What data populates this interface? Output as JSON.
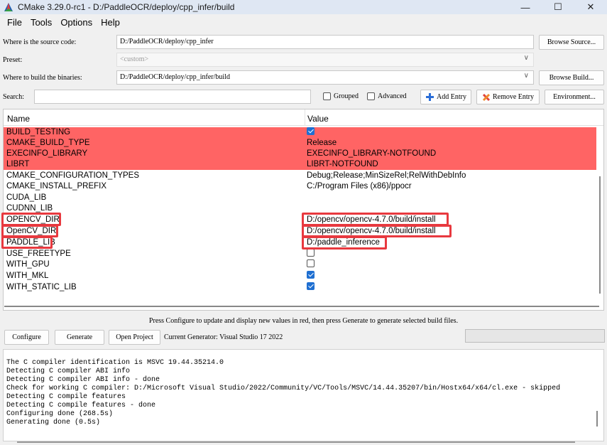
{
  "window": {
    "title": "CMake 3.29.0-rc1 - D:/PaddleOCR/deploy/cpp_infer/build",
    "minimize": "—",
    "maximize": "☐",
    "close": "✕"
  },
  "menu": [
    "File",
    "Tools",
    "Options",
    "Help"
  ],
  "source": {
    "label": "Where is the source code:",
    "value": "D:/PaddleOCR/deploy/cpp_infer",
    "browse": "Browse Source..."
  },
  "preset": {
    "label": "Preset:",
    "value": "<custom>"
  },
  "build": {
    "label": "Where to build the binaries:",
    "value": "D:/PaddleOCR/deploy/cpp_infer/build",
    "browse": "Browse Build..."
  },
  "search": {
    "label": "Search:",
    "value": "",
    "grouped": "Grouped",
    "advanced": "Advanced",
    "add_entry": "Add Entry",
    "remove_entry": "Remove Entry",
    "environment": "Environment..."
  },
  "table": {
    "headers": {
      "name": "Name",
      "value": "Value"
    },
    "rows": [
      {
        "name": "BUILD_TESTING",
        "value": "",
        "checkbox": true,
        "red": true
      },
      {
        "name": "CMAKE_BUILD_TYPE",
        "value": "Release",
        "red": true
      },
      {
        "name": "EXECINFO_LIBRARY",
        "value": "EXECINFO_LIBRARY-NOTFOUND",
        "red": true
      },
      {
        "name": "LIBRT",
        "value": "LIBRT-NOTFOUND",
        "red": true
      },
      {
        "name": "CMAKE_CONFIGURATION_TYPES",
        "value": "Debug;Release;MinSizeRel;RelWithDebInfo"
      },
      {
        "name": "CMAKE_INSTALL_PREFIX",
        "value": "C:/Program Files (x86)/ppocr"
      },
      {
        "name": "CUDA_LIB",
        "value": ""
      },
      {
        "name": "CUDNN_LIB",
        "value": ""
      },
      {
        "name": "OPENCV_DIR",
        "value": "D:/opencv/opencv-4.7.0/build/install"
      },
      {
        "name": "OpenCV_DIR",
        "value": "D:/opencv/opencv-4.7.0/build/install"
      },
      {
        "name": "PADDLE_LIB",
        "value": "D:/paddle_inference"
      },
      {
        "name": "USE_FREETYPE",
        "value": "",
        "checkbox": false
      },
      {
        "name": "WITH_GPU",
        "value": "",
        "checkbox": false
      },
      {
        "name": "WITH_MKL",
        "value": "",
        "checkbox": true
      },
      {
        "name": "WITH_STATIC_LIB",
        "value": "",
        "checkbox": true
      }
    ]
  },
  "hint": "Press Configure to update and display new values in red, then press Generate to generate selected build files.",
  "actions": {
    "configure": "Configure",
    "generate": "Generate",
    "open_project": "Open Project",
    "current_generator": "Current Generator: Visual Studio 17 2022"
  },
  "log": [
    "The C compiler identification is MSVC 19.44.35214.0",
    "Detecting C compiler ABI info",
    "Detecting C compiler ABI info - done",
    "Check for working C compiler: D:/Microsoft Visual Studio/2022/Community/VC/Tools/MSVC/14.44.35207/bin/Hostx64/x64/cl.exe - skipped",
    "Detecting C compile features",
    "Detecting C compile features - done",
    "Configuring done (268.5s)",
    "Generating done (0.5s)"
  ],
  "colors": {
    "new_value_row": "#ff6464",
    "highlight_box": "#e8393f",
    "checkbox_on": "#1f6fd1"
  }
}
